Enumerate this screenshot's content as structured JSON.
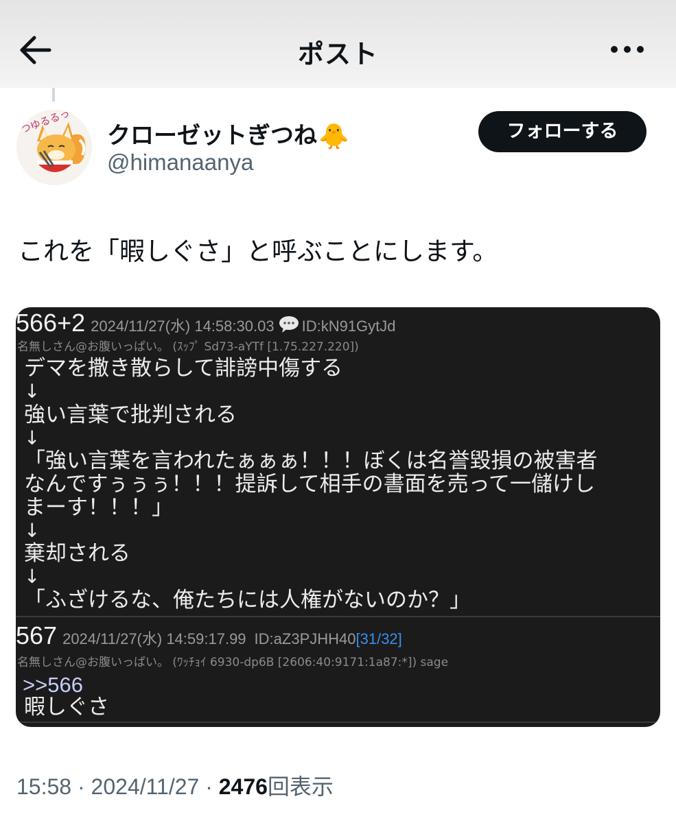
{
  "header": {
    "title": "ポスト"
  },
  "author": {
    "display_name": "クローゼットぎつね",
    "emoji": "🐥",
    "handle": "@himanaanya",
    "follow_label": "フォローする",
    "avatar_text": "つゆるるっ"
  },
  "tweet": {
    "text": "これを「暇しぐさ」と呼ぶことにします。"
  },
  "media": {
    "post1": {
      "number": "566+2",
      "meta": "2024/11/27(水) 14:58:30.03",
      "id": "ID:kN91GytJd",
      "sub": "名無しさん@お腹いっぱい。 (ｽｯﾌﾟ Sd73-aYTf [1.75.227.220])",
      "lines": [
        "デマを撒き散らして誹謗中傷する",
        "↓",
        "強い言葉で批判される",
        "↓",
        "「強い言葉を言われたぁぁぁ！！！ぼくは名誉毀損の被害者",
        "なんですぅぅぅ！！！提訴して相手の書面を売って一儲けし",
        "まーす！！！」",
        "↓",
        "棄却される",
        "↓",
        "「ふざけるな、俺たちには人権がないのか？」"
      ]
    },
    "post2": {
      "number": "567",
      "meta": "2024/11/27(水) 14:59:17.99",
      "id": "ID:aZ3PJHH40",
      "count": "[31/32]",
      "sub": "名無しさん@お腹いっぱい。 (ﾜｯﾁｮｲ 6930-dp6B [2606:40:9171:1a87:*]) sage",
      "anchor": ">>566",
      "text": "暇しぐさ"
    }
  },
  "footer": {
    "time": "15:58",
    "separator": "·",
    "date": "2024/11/27",
    "views_count": "2476",
    "views_label": "回表示"
  }
}
